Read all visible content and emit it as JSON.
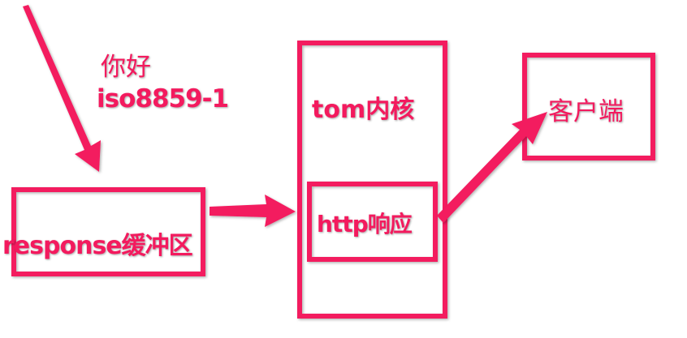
{
  "colors": {
    "accent": "#f31a5e"
  },
  "labels": {
    "greeting": "你好",
    "encoding": "iso8859-1",
    "response_buffer": "response缓冲区",
    "tomcat_core": "tom内核",
    "http_response": "http响应",
    "client": "客户端"
  }
}
